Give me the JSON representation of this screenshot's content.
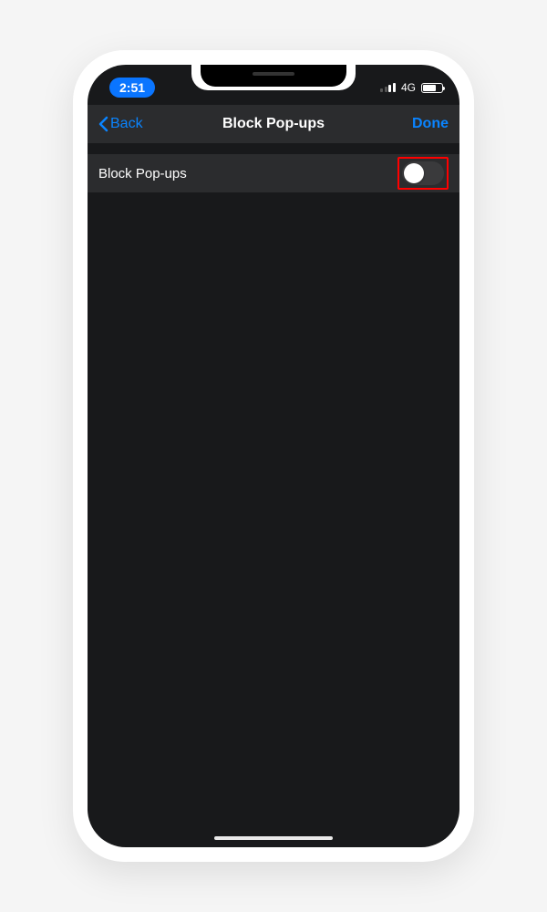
{
  "status_bar": {
    "time": "2:51",
    "network_label": "4G"
  },
  "nav": {
    "back_label": "Back",
    "title": "Block Pop-ups",
    "done_label": "Done"
  },
  "settings": {
    "block_popups": {
      "label": "Block Pop-ups",
      "enabled": false
    }
  }
}
